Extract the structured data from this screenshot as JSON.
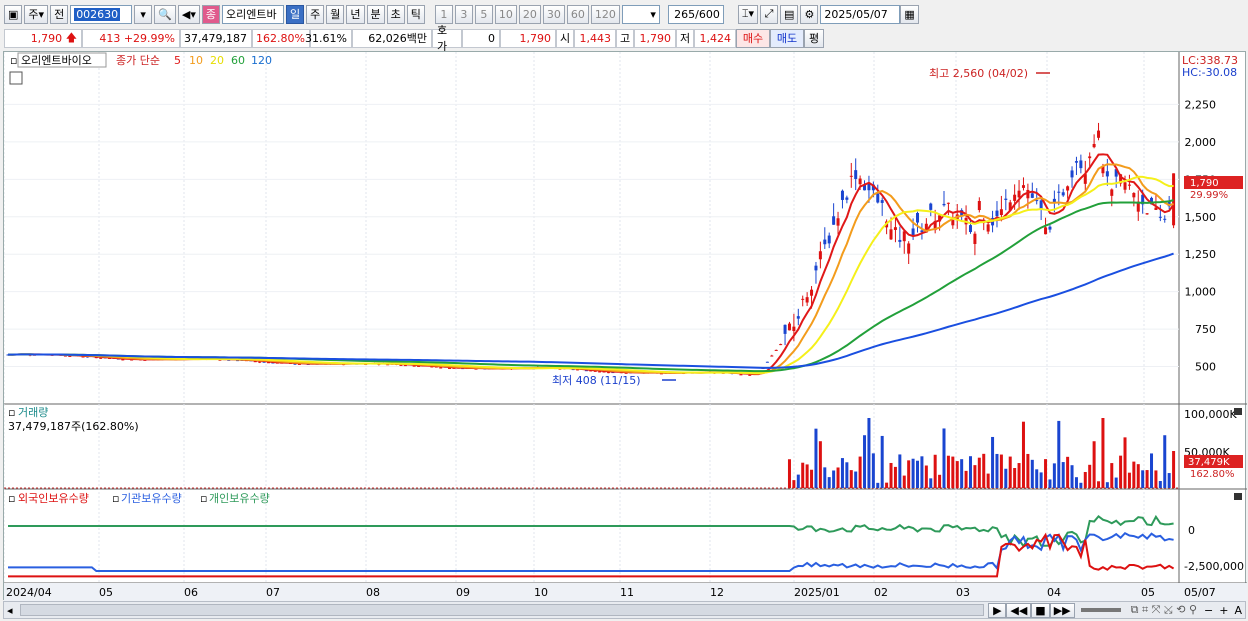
{
  "toolbar": {
    "type_label": "주",
    "prev_label": "전",
    "code": "002630",
    "name": "오리엔트바",
    "period_tabs": [
      "일",
      "주",
      "월",
      "년",
      "분",
      "초",
      "틱"
    ],
    "intervals": [
      "1",
      "3",
      "5",
      "10",
      "20",
      "30",
      "60",
      "120"
    ],
    "count": "265",
    "count_max": "/600",
    "date": "2025/05/07"
  },
  "quote": {
    "price": "1,790",
    "change": "413",
    "change_pct": "+29.99%",
    "volume": "37,479,187",
    "vol_ratio": "162.80%",
    "turnover": "31.61%",
    "amount": "62,026백만",
    "hoga_label": "호가",
    "hoga_value": "0",
    "hoga_price": "1,790",
    "open_label": "시",
    "open": "1,443",
    "high_label": "고",
    "high": "1,790",
    "low_label": "저",
    "low": "1,424",
    "buy_label": "매수",
    "sell_label": "매도",
    "avg_label": "평"
  },
  "legend": {
    "stock_name": "오리엔트바이오",
    "ma_label": "종가 단순",
    "ma_periods": [
      "5",
      "10",
      "20",
      "60",
      "120"
    ]
  },
  "colors": {
    "up": "#dd1111",
    "down": "#1a45d0",
    "ma5": "#e01818",
    "ma10": "#f39c1c",
    "ma20": "#f5f01a",
    "ma60": "#22a03a",
    "ma120": "#1a4fe0",
    "foreign": "#dd1111",
    "institution": "#2a5fe0",
    "individual": "#2e9a5a",
    "price_tag": "#dd2222"
  },
  "annotations": {
    "high": "최고 2,560 (04/02)",
    "low": "최저 408 (11/15)"
  },
  "price_axis": {
    "lc": "LC:338.73",
    "hc": "HC:-30.08",
    "ticks": [
      "2,250",
      "2,000",
      "1,750",
      "1,500",
      "1,250",
      "1,000",
      "750",
      "500"
    ],
    "current": "1,790",
    "current_pct": "29.99%"
  },
  "volume_panel": {
    "title": "거래량",
    "info": "37,479,187주(162.80%)",
    "ticks": [
      "100,000K",
      "50,000K"
    ],
    "current": "37,479K",
    "current_pct": "162.80%"
  },
  "investor_panel": {
    "legend": [
      "외국인보유수량",
      "기관보유수량",
      "개인보유수량"
    ],
    "ticks": [
      "0",
      "-2,500,000"
    ]
  },
  "x_axis": {
    "labels": [
      "2024/04",
      "05",
      "06",
      "07",
      "08",
      "09",
      "10",
      "11",
      "12",
      "2025/01",
      "02",
      "03",
      "04",
      "05",
      "05/07"
    ]
  },
  "chart_data": {
    "type": "candlestick",
    "title": "오리엔트바이오",
    "x_range": [
      "2024/04",
      "2025/05/07"
    ],
    "y_range": [
      408,
      2560
    ],
    "last": {
      "open": 1443,
      "high": 1790,
      "low": 1424,
      "close": 1790,
      "change": 413,
      "change_pct": 29.99,
      "volume": 37479187
    },
    "extremes": {
      "high": {
        "value": 2560,
        "date": "04/02"
      },
      "low": {
        "value": 408,
        "date": "11/15"
      }
    },
    "moving_averages": [
      "5",
      "10",
      "20",
      "60",
      "120"
    ],
    "series_approx": {
      "x": [
        "2024/04",
        "05",
        "06",
        "07",
        "08",
        "09",
        "10",
        "11",
        "12",
        "2025/01",
        "02",
        "03",
        "04",
        "05"
      ],
      "close": [
        580,
        560,
        540,
        520,
        510,
        500,
        470,
        450,
        500,
        1750,
        1500,
        1650,
        2000,
        1790
      ],
      "ma120": [
        590,
        575,
        560,
        545,
        530,
        515,
        500,
        485,
        470,
        700,
        950,
        1100,
        1250,
        1330
      ]
    }
  },
  "scroll_buttons": [
    "▶",
    "◀◀",
    "■",
    "▶▶"
  ]
}
